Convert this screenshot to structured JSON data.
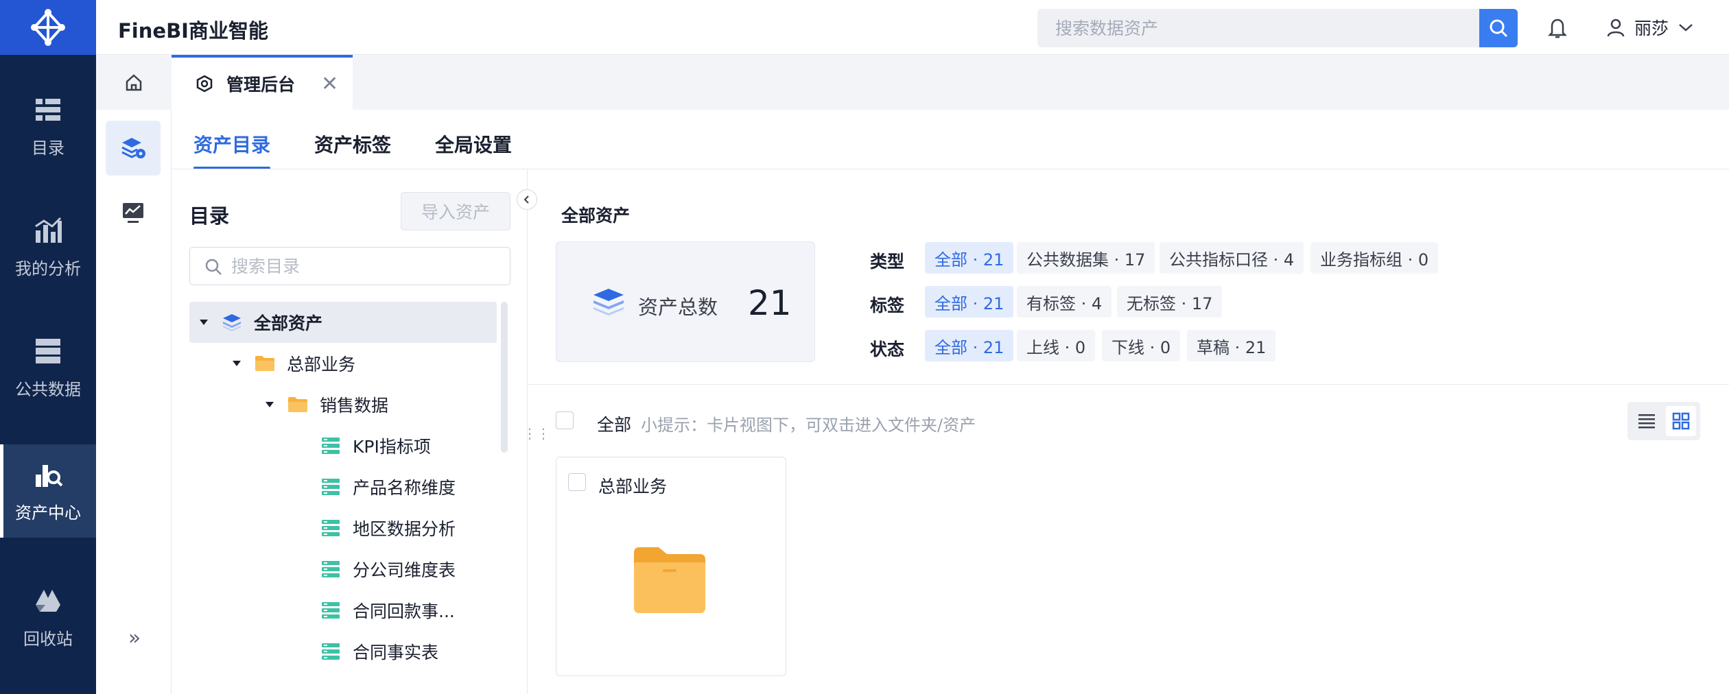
{
  "app": {
    "title": "FineBI商业智能"
  },
  "header": {
    "search_placeholder": "搜索数据资产",
    "user_name": "丽莎"
  },
  "nav": {
    "items": [
      {
        "label": "目录"
      },
      {
        "label": "我的分析"
      },
      {
        "label": "公共数据"
      },
      {
        "label": "资产中心"
      },
      {
        "label": "回收站"
      }
    ]
  },
  "tabs": {
    "admin_label": "管理后台"
  },
  "main_tabs": [
    "资产目录",
    "资产标签",
    "全局设置"
  ],
  "directory": {
    "title": "目录",
    "import_label": "导入资产",
    "search_placeholder": "搜索目录",
    "tree": [
      {
        "label": "全部资产"
      },
      {
        "label": "总部业务"
      },
      {
        "label": "销售数据"
      },
      {
        "label": "KPI指标项"
      },
      {
        "label": "产品名称维度"
      },
      {
        "label": "地区数据分析"
      },
      {
        "label": "分公司维度表"
      },
      {
        "label": "合同回款事..."
      },
      {
        "label": "合同事实表"
      }
    ]
  },
  "content": {
    "crumb": "全部资产",
    "total_label": "资产总数",
    "total_value": "21",
    "filters": {
      "type": {
        "label": "类型",
        "chips": [
          "全部 · 21",
          "公共数据集 · 17",
          "公共指标口径 · 4",
          "业务指标组 · 0"
        ]
      },
      "tag": {
        "label": "标签",
        "chips": [
          "全部 · 21",
          "有标签 · 4",
          "无标签 · 17"
        ]
      },
      "status": {
        "label": "状态",
        "chips": [
          "全部 · 21",
          "上线 · 0",
          "下线 · 0",
          "草稿 · 21"
        ]
      }
    },
    "select_all_label": "全部",
    "hint": "小提示：卡片视图下，可双击进入文件夹/资产",
    "cards": [
      {
        "name": "总部业务"
      }
    ]
  },
  "colors": {
    "nav_bg": "#10254b",
    "logo_bg": "#2456d3",
    "accent": "#2f6ae0",
    "folder": "#f7b13c"
  }
}
